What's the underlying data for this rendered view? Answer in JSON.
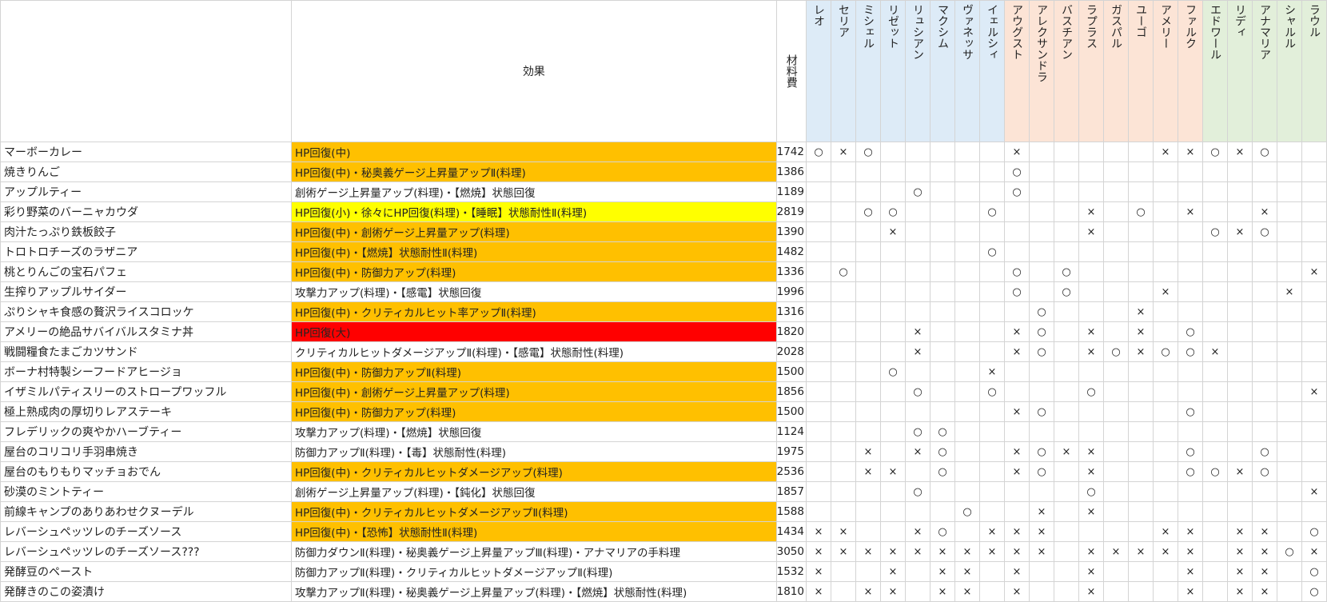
{
  "header": {
    "effect": "効果",
    "cost": "材料費",
    "characters": [
      {
        "name": "レオ",
        "group": "blue"
      },
      {
        "name": "セリア",
        "group": "blue"
      },
      {
        "name": "ミシェル",
        "group": "blue"
      },
      {
        "name": "リゼット",
        "group": "blue"
      },
      {
        "name": "リュシアン",
        "group": "blue"
      },
      {
        "name": "マクシム",
        "group": "blue"
      },
      {
        "name": "ヴァネッサ",
        "group": "blue"
      },
      {
        "name": "イェルシィ",
        "group": "blue"
      },
      {
        "name": "アウグスト",
        "group": "orange"
      },
      {
        "name": "アレクサンドラ",
        "group": "orange"
      },
      {
        "name": "バスチアン",
        "group": "orange"
      },
      {
        "name": "ラプラス",
        "group": "orange"
      },
      {
        "name": "ガスパル",
        "group": "orange"
      },
      {
        "name": "ユーゴ",
        "group": "orange"
      },
      {
        "name": "アメリー",
        "group": "orange"
      },
      {
        "name": "ファルク",
        "group": "orange"
      },
      {
        "name": "エドワール",
        "group": "green"
      },
      {
        "name": "リディ",
        "group": "green"
      },
      {
        "name": "アナマリア",
        "group": "green"
      },
      {
        "name": "シャルル",
        "group": "green"
      },
      {
        "name": "ラウル",
        "group": "green"
      }
    ]
  },
  "colors": {
    "orange": "#ffc000",
    "yellow": "#ffff00",
    "red": "#ff0000",
    "none": "#ffffff",
    "group_blue": "#ddebf7",
    "group_orange": "#fce4d6",
    "group_green": "#e2efda"
  },
  "rows": [
    {
      "name": "マーボーカレー",
      "effect": "HP回復(中)",
      "bg": "orange",
      "cost": "1742",
      "marks": [
        "○",
        "×",
        "○",
        "",
        "",
        "",
        "",
        "",
        "×",
        "",
        "",
        "",
        "",
        "",
        "×",
        "×",
        "○",
        "×",
        "○",
        "",
        ""
      ]
    },
    {
      "name": "焼きりんご",
      "effect": "HP回復(中)・秘奥義ゲージ上昇量アップⅡ(料理)",
      "bg": "orange",
      "cost": "1386",
      "marks": [
        "",
        "",
        "",
        "",
        "",
        "",
        "",
        "",
        "○",
        "",
        "",
        "",
        "",
        "",
        "",
        "",
        "",
        "",
        "",
        "",
        ""
      ]
    },
    {
      "name": "アップルティー",
      "effect": "創術ゲージ上昇量アップ(料理)・【燃焼】状態回復",
      "bg": "none",
      "cost": "1189",
      "marks": [
        "",
        "",
        "",
        "",
        "○",
        "",
        "",
        "",
        "○",
        "",
        "",
        "",
        "",
        "",
        "",
        "",
        "",
        "",
        "",
        "",
        ""
      ]
    },
    {
      "name": "彩り野菜のバーニャカウダ",
      "effect": "HP回復(小)・徐々にHP回復(料理)・【睡眠】状態耐性Ⅱ(料理)",
      "bg": "yellow",
      "cost": "2819",
      "marks": [
        "",
        "",
        "○",
        "○",
        "",
        "",
        "",
        "○",
        "",
        "",
        "",
        "×",
        "",
        "○",
        "",
        "×",
        "",
        "",
        "×",
        "",
        ""
      ]
    },
    {
      "name": "肉汁たっぷり鉄板餃子",
      "effect": "HP回復(中)・創術ゲージ上昇量アップ(料理)",
      "bg": "orange",
      "cost": "1390",
      "marks": [
        "",
        "",
        "",
        "×",
        "",
        "",
        "",
        "",
        "",
        "",
        "",
        "×",
        "",
        "",
        "",
        "",
        "○",
        "×",
        "○",
        "",
        ""
      ]
    },
    {
      "name": "トロトロチーズのラザニア",
      "effect": "HP回復(中)・【燃焼】状態耐性Ⅱ(料理)",
      "bg": "orange",
      "cost": "1482",
      "marks": [
        "",
        "",
        "",
        "",
        "",
        "",
        "",
        "○",
        "",
        "",
        "",
        "",
        "",
        "",
        "",
        "",
        "",
        "",
        "",
        "",
        ""
      ]
    },
    {
      "name": "桃とりんごの宝石パフェ",
      "effect": "HP回復(中)・防御力アップ(料理)",
      "bg": "orange",
      "cost": "1336",
      "marks": [
        "",
        "○",
        "",
        "",
        "",
        "",
        "",
        "",
        "○",
        "",
        "○",
        "",
        "",
        "",
        "",
        "",
        "",
        "",
        "",
        "",
        "×"
      ]
    },
    {
      "name": "生搾りアップルサイダー",
      "effect": "攻撃力アップ(料理)・【感電】状態回復",
      "bg": "none",
      "cost": "1996",
      "marks": [
        "",
        "",
        "",
        "",
        "",
        "",
        "",
        "",
        "○",
        "",
        "○",
        "",
        "",
        "",
        "×",
        "",
        "",
        "",
        "",
        "×",
        ""
      ]
    },
    {
      "name": "ぷりシャキ食感の贅沢ライスコロッケ",
      "effect": "HP回復(中)・クリティカルヒット率アップⅡ(料理)",
      "bg": "orange",
      "cost": "1316",
      "marks": [
        "",
        "",
        "",
        "",
        "",
        "",
        "",
        "",
        "",
        "○",
        "",
        "",
        "",
        "×",
        "",
        "",
        "",
        "",
        "",
        "",
        ""
      ]
    },
    {
      "name": "アメリーの絶品サバイバルスタミナ丼",
      "effect": "HP回復(大)",
      "bg": "red",
      "cost": "1820",
      "marks": [
        "",
        "",
        "",
        "",
        "×",
        "",
        "",
        "",
        "×",
        "○",
        "",
        "×",
        "",
        "×",
        "",
        "○",
        "",
        "",
        "",
        "",
        ""
      ]
    },
    {
      "name": "戦闘糧食たまごカツサンド",
      "effect": "クリティカルヒットダメージアップⅡ(料理)・【感電】状態耐性(料理)",
      "bg": "none",
      "cost": "2028",
      "marks": [
        "",
        "",
        "",
        "",
        "×",
        "",
        "",
        "",
        "×",
        "○",
        "",
        "×",
        "○",
        "×",
        "○",
        "○",
        "×",
        "",
        "",
        "",
        ""
      ]
    },
    {
      "name": "ボーナ村特製シーフードアヒージョ",
      "effect": "HP回復(中)・防御力アップⅡ(料理)",
      "bg": "orange",
      "cost": "1500",
      "marks": [
        "",
        "",
        "",
        "○",
        "",
        "",
        "",
        "×",
        "",
        "",
        "",
        "",
        "",
        "",
        "",
        "",
        "",
        "",
        "",
        "",
        ""
      ]
    },
    {
      "name": "イザミルパティスリーのストロープワッフル",
      "effect": "HP回復(中)・創術ゲージ上昇量アップ(料理)",
      "bg": "orange",
      "cost": "1856",
      "marks": [
        "",
        "",
        "",
        "",
        "○",
        "",
        "",
        "○",
        "",
        "",
        "",
        "○",
        "",
        "",
        "",
        "",
        "",
        "",
        "",
        "",
        "×"
      ]
    },
    {
      "name": "極上熟成肉の厚切りレアステーキ",
      "effect": "HP回復(中)・防御力アップ(料理)",
      "bg": "orange",
      "cost": "1500",
      "marks": [
        "",
        "",
        "",
        "",
        "",
        "",
        "",
        "",
        "×",
        "○",
        "",
        "",
        "",
        "",
        "",
        "○",
        "",
        "",
        "",
        "",
        ""
      ]
    },
    {
      "name": "フレデリックの爽やかハーブティー",
      "effect": "攻撃力アップ(料理)・【燃焼】状態回復",
      "bg": "none",
      "cost": "1124",
      "marks": [
        "",
        "",
        "",
        "",
        "○",
        "○",
        "",
        "",
        "",
        "",
        "",
        "",
        "",
        "",
        "",
        "",
        "",
        "",
        "",
        "",
        ""
      ]
    },
    {
      "name": "屋台のコリコリ手羽串焼き",
      "effect": "防御力アップⅡ(料理)・【毒】状態耐性(料理)",
      "bg": "none",
      "cost": "1975",
      "marks": [
        "",
        "",
        "×",
        "",
        "×",
        "○",
        "",
        "",
        "×",
        "○",
        "×",
        "×",
        "",
        "",
        "",
        "○",
        "",
        "",
        "○",
        "",
        ""
      ]
    },
    {
      "name": "屋台のもりもりマッチョおでん",
      "effect": "HP回復(中)・クリティカルヒットダメージアップ(料理)",
      "bg": "orange",
      "cost": "2536",
      "marks": [
        "",
        "",
        "×",
        "×",
        "",
        "○",
        "",
        "",
        "×",
        "○",
        "",
        "×",
        "",
        "",
        "",
        "○",
        "○",
        "×",
        "○",
        "",
        ""
      ]
    },
    {
      "name": "砂漠のミントティー",
      "effect": "創術ゲージ上昇量アップ(料理)・【鈍化】状態回復",
      "bg": "none",
      "cost": "1857",
      "marks": [
        "",
        "",
        "",
        "",
        "○",
        "",
        "",
        "",
        "",
        "",
        "",
        "○",
        "",
        "",
        "",
        "",
        "",
        "",
        "",
        "",
        "×"
      ]
    },
    {
      "name": "前線キャンプのありあわせクヌーデル",
      "effect": "HP回復(中)・クリティカルヒットダメージアップⅡ(料理)",
      "bg": "orange",
      "cost": "1588",
      "marks": [
        "",
        "",
        "",
        "",
        "",
        "",
        "○",
        "",
        "",
        "×",
        "",
        "×",
        "",
        "",
        "",
        "",
        "",
        "",
        "",
        "",
        ""
      ]
    },
    {
      "name": "レバーシュペッツレのチーズソース",
      "effect": "HP回復(中)・【恐怖】状態耐性Ⅱ(料理)",
      "bg": "orange",
      "cost": "1434",
      "marks": [
        "×",
        "×",
        "",
        "",
        "×",
        "○",
        "",
        "×",
        "×",
        "×",
        "",
        "",
        "",
        "",
        "×",
        "×",
        "",
        "×",
        "×",
        "",
        "○"
      ]
    },
    {
      "name": "レバーシュペッツレのチーズソース???",
      "effect": "防御力ダウンⅡ(料理)・秘奥義ゲージ上昇量アップⅢ(料理)・アナマリアの手料理",
      "bg": "none",
      "cost": "3050",
      "marks": [
        "×",
        "×",
        "×",
        "×",
        "×",
        "×",
        "×",
        "×",
        "×",
        "×",
        "",
        "×",
        "×",
        "×",
        "×",
        "×",
        "",
        "×",
        "×",
        "○",
        "×"
      ]
    },
    {
      "name": "発酵豆のペースト",
      "effect": "防御力アップⅡ(料理)・クリティカルヒットダメージアップⅡ(料理)",
      "bg": "none",
      "cost": "1532",
      "marks": [
        "×",
        "",
        "",
        "×",
        "",
        "×",
        "×",
        "",
        "×",
        "",
        "",
        "×",
        "",
        "",
        "",
        "×",
        "",
        "×",
        "×",
        "",
        "○"
      ]
    },
    {
      "name": "発酵きのこの姿漬け",
      "effect": "攻撃力アップⅡ(料理)・秘奥義ゲージ上昇量アップ(料理)・【燃焼】状態耐性(料理)",
      "bg": "none",
      "cost": "1810",
      "marks": [
        "×",
        "",
        "×",
        "×",
        "",
        "×",
        "×",
        "",
        "×",
        "",
        "",
        "×",
        "",
        "",
        "",
        "×",
        "",
        "×",
        "×",
        "",
        "○"
      ]
    }
  ]
}
